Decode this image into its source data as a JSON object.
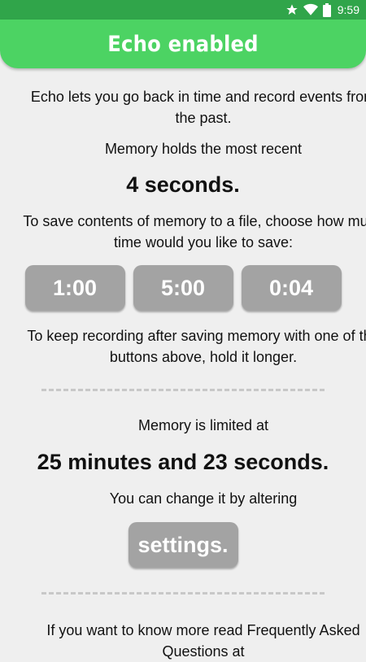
{
  "status_bar": {
    "time": "9:59",
    "icons": [
      "star-icon",
      "wifi-icon",
      "battery-icon"
    ],
    "background": "#30a54a"
  },
  "header": {
    "title": "Echo enabled",
    "background": "#4cd363"
  },
  "main": {
    "intro": "Echo lets you go back in time and record events from the past.",
    "memory_prefix": "Memory holds the most recent",
    "memory_value": "4 seconds.",
    "save_prompt": "To save contents of memory to a file, choose how much time would you like to save:",
    "save_buttons": [
      "1:00",
      "5:00",
      "0:04"
    ],
    "keep_recording_hint": "To keep recording after saving memory with one of the buttons above, hold it longer.",
    "limit_prefix": "Memory is limited at",
    "limit_value": "25 minutes and 23 seconds.",
    "change_hint": "You can change it by altering",
    "settings_label": "settings.",
    "faq_text": "If you want to know more read Frequently Asked Questions at"
  },
  "colors": {
    "button": "#a3a3a3",
    "divider": "#c8c8c8",
    "background": "#efefef"
  }
}
